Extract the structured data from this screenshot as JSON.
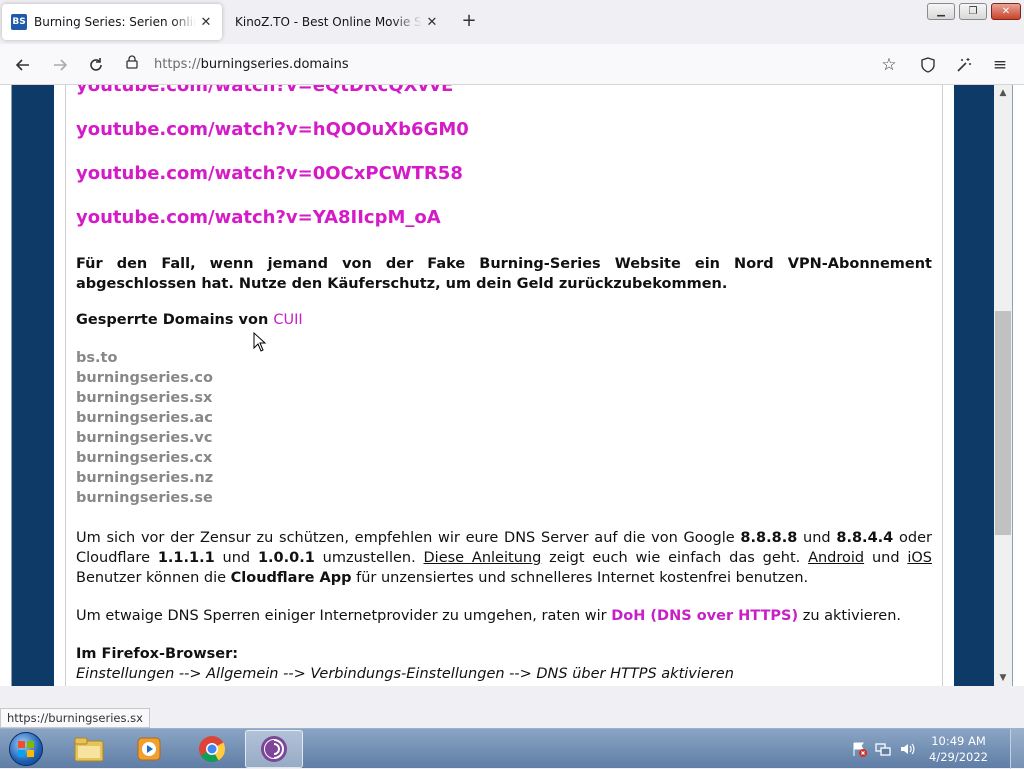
{
  "browser": {
    "tabs": [
      {
        "title": "Burning Series: Serien online sehen",
        "favicon": "BS",
        "active": true
      },
      {
        "title": "KinoZ.TO - Best Online Movie Streaming",
        "active": false
      }
    ],
    "url_scheme": "https://",
    "url_host": "burningseries.domains",
    "status_url": "https://burningseries.sx"
  },
  "page": {
    "youtube_links": [
      "youtube.com/watch?v=eQtDRcQXvvE",
      "youtube.com/watch?v=hQOOuXb6GM0",
      "youtube.com/watch?v=0OCxPCWTR58",
      "youtube.com/watch?v=YA8IIcpM_oA"
    ],
    "warning_text": "Für den Fall, wenn jemand von der Fake Burning-Series Website ein Nord VPN-Abonnement abgeschlossen hat. Nutze den Käuferschutz, um dein Geld zurückzubekommen.",
    "blocked_label": "Gesperrte Domains von",
    "blocked_source": "CUII",
    "blocked_domains": [
      "bs.to",
      "burningseries.co",
      "burningseries.sx",
      "burningseries.ac",
      "burningseries.vc",
      "burningseries.cx",
      "burningseries.nz",
      "burningseries.se"
    ],
    "dns": {
      "p1": "Um sich vor der Zensur zu schützen, empfehlen wir eure DNS Server auf die von Google ",
      "google1": "8.8.8.8",
      "and1": " und ",
      "google2": "8.8.4.4",
      "p2": " oder Cloudflare ",
      "cf1": "1.1.1.1",
      "and2": " und ",
      "cf2": "1.0.0.1",
      "p3": " umzustellen. ",
      "guide_link": "Diese Anleitung",
      "p4": " zeigt euch wie einfach das geht. ",
      "android_link": "Android",
      "and3": " und ",
      "ios_link": "iOS",
      "p5": " Benutzer können die ",
      "cf_app": "Cloudflare App",
      "p6": " für unzensiertes und schnelleres Internet kostenfrei benutzen."
    },
    "doh": {
      "p1": "Um etwaige DNS Sperren einiger Internetprovider zu umgehen, raten wir ",
      "link": "DoH (DNS over HTTPS)",
      "p2": " zu aktivieren."
    },
    "firefox_heading": "Im Firefox-Browser:",
    "firefox_path": "Einstellungen --> Allgemein --> Verbindungs-Einstellungen --> DNS über HTTPS aktivieren"
  },
  "taskbar": {
    "time": "10:49 AM",
    "date": "4/29/2022"
  },
  "colors": {
    "link_pink": "#d51ac8",
    "side_navy": "#0e3a67"
  }
}
